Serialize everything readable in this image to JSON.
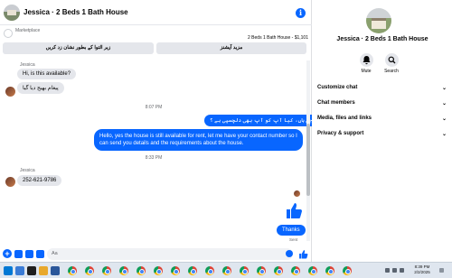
{
  "chat": {
    "title": "Jessica · 2 Beds 1 Bath House",
    "marketplace_label": "Marketplace",
    "listing": "2 Beds 1 Bath House - $1,101",
    "quick_replies": [
      "زیر التوا کے بطور نشان زد کریں",
      "مزید آپشنز"
    ],
    "messages": [
      {
        "sender": "Jessica",
        "text": "Hi, is this available?",
        "direction": "in"
      },
      {
        "text": "پیغام بھیج دیا گیا",
        "direction": "in"
      },
      {
        "time": "8:07 PM"
      },
      {
        "text": "جی ہاں، کیا آپ کو آپ بھی دلچسپی ہے ؟",
        "direction": "out"
      },
      {
        "text": "Hello, yes the house is still available for rent, let me have your contact number so I can send you details and the requirements about the house.",
        "direction": "out"
      },
      {
        "time": "8:33 PM"
      },
      {
        "sender": "Jessica",
        "text": "252-621-9786",
        "direction": "in"
      },
      {
        "text": "Thanks",
        "direction": "out"
      }
    ],
    "sent_status": "Sent",
    "composer_placeholder": "Aa"
  },
  "details": {
    "title": "Jessica · 2 Beds 1 Bath House",
    "actions": [
      {
        "label": "Mute",
        "icon": "bell-icon"
      },
      {
        "label": "Search",
        "icon": "search-icon"
      }
    ],
    "sections": [
      "Customize chat",
      "Chat members",
      "Media, files and links",
      "Privacy & support"
    ]
  },
  "taskbar": {
    "time": "8:39 PM",
    "date": "2/2/2025"
  },
  "colors": {
    "accent": "#0866ff",
    "incoming_bubble": "#e4e6eb",
    "taskbar": "#dfe6ef"
  }
}
